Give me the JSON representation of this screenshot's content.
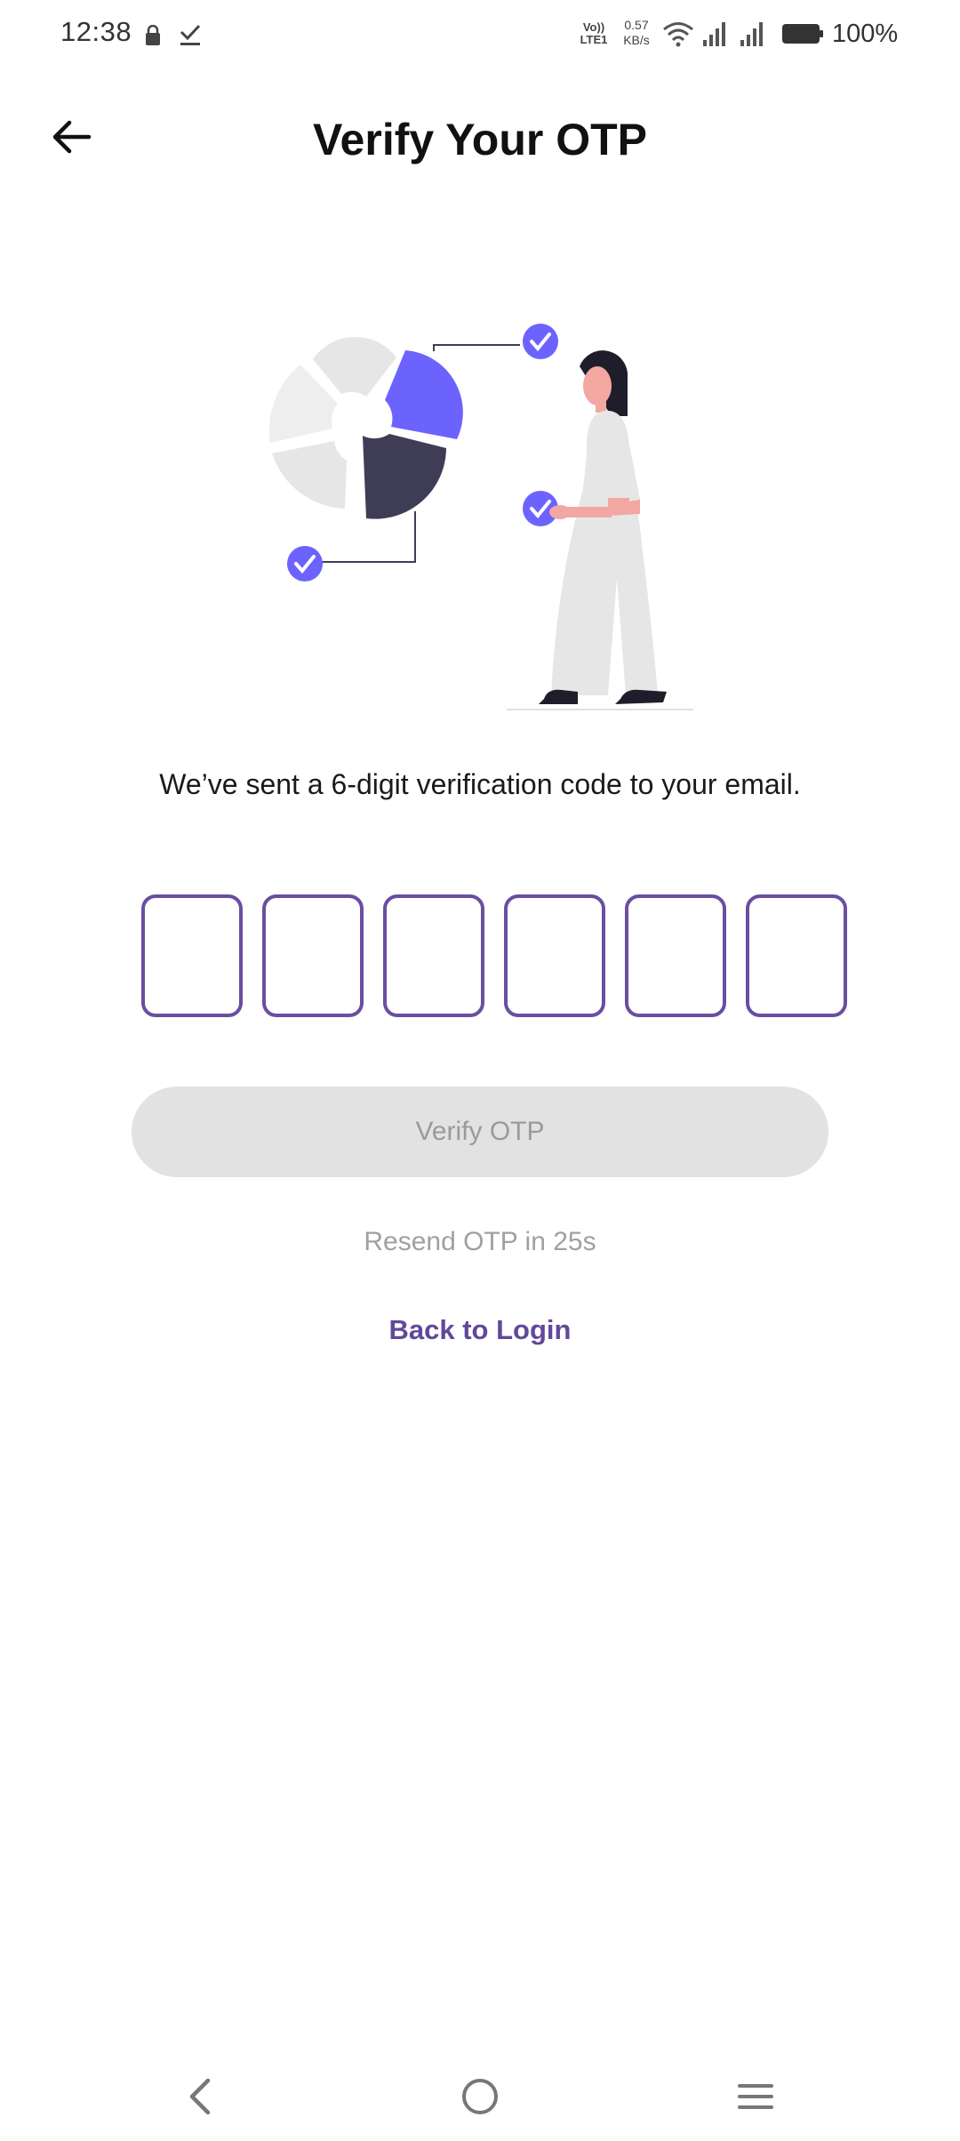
{
  "status_bar": {
    "time": "12:38",
    "volte": "Vo)) LTE1",
    "speed_value": "0.57",
    "speed_unit": "KB/s",
    "battery": "100%"
  },
  "header": {
    "title": "Verify Your OTP",
    "back_icon": "arrow-left-icon"
  },
  "body": {
    "message": "We’ve sent a 6-digit verification code to your email.",
    "otp_boxes": [
      "",
      "",
      "",
      "",
      "",
      ""
    ],
    "verify_label": "Verify OTP",
    "resend_text": "Resend OTP in 25s",
    "back_to_login": "Back to Login"
  },
  "nav_bar": {
    "icons": [
      "back-icon",
      "home-icon",
      "menu-icon"
    ]
  },
  "colors": {
    "accent": "#6c63ff",
    "box_border": "#6a4ea0",
    "link": "#62489a",
    "dark_slice": "#3f3d56",
    "button_disabled_bg": "#e2e2e2"
  }
}
